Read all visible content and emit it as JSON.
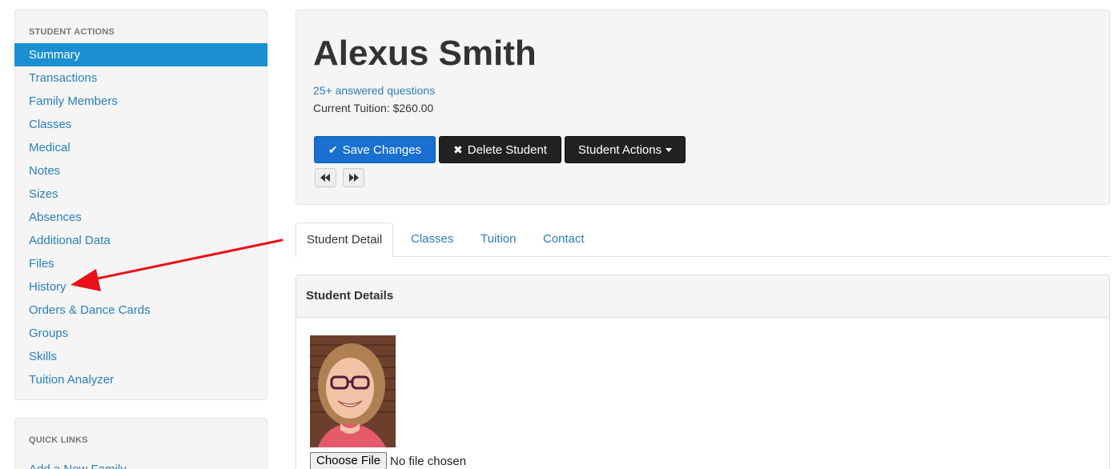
{
  "sidebar": {
    "actions_header": "STUDENT ACTIONS",
    "items": [
      {
        "label": "Summary",
        "active": true
      },
      {
        "label": "Transactions"
      },
      {
        "label": "Family Members"
      },
      {
        "label": "Classes"
      },
      {
        "label": "Medical"
      },
      {
        "label": "Notes"
      },
      {
        "label": "Sizes"
      },
      {
        "label": "Absences"
      },
      {
        "label": "Additional Data"
      },
      {
        "label": "Files"
      },
      {
        "label": "History"
      },
      {
        "label": "Orders & Dance Cards"
      },
      {
        "label": "Groups"
      },
      {
        "label": "Skills"
      },
      {
        "label": "Tuition Analyzer"
      }
    ],
    "quick_links_header": "QUICK LINKS",
    "quick_links": [
      {
        "label": "Add a New Family"
      }
    ]
  },
  "student": {
    "name": "Alexus Smith",
    "answered_link": "25+ answered questions",
    "tuition_text": "Current Tuition: $260.00"
  },
  "toolbar": {
    "save_label": "Save Changes",
    "save_icon": "check-icon",
    "delete_label": "Delete Student",
    "delete_icon": "x-icon",
    "actions_label": "Student Actions",
    "prev_icon": "backward-icon",
    "next_icon": "forward-icon"
  },
  "tabs": [
    {
      "label": "Student Detail",
      "active": true
    },
    {
      "label": "Classes"
    },
    {
      "label": "Tuition"
    },
    {
      "label": "Contact"
    }
  ],
  "details": {
    "heading": "Student Details",
    "choose_file_label": "Choose File",
    "file_status": "No file chosen"
  },
  "annotation": {
    "arrow_color": "#e8111b",
    "points_to": "History"
  },
  "colors": {
    "link": "#2a7fbf",
    "active_item": "#1a8fd1",
    "primary_button": "#1a6fd0",
    "dark_button": "#222222"
  }
}
